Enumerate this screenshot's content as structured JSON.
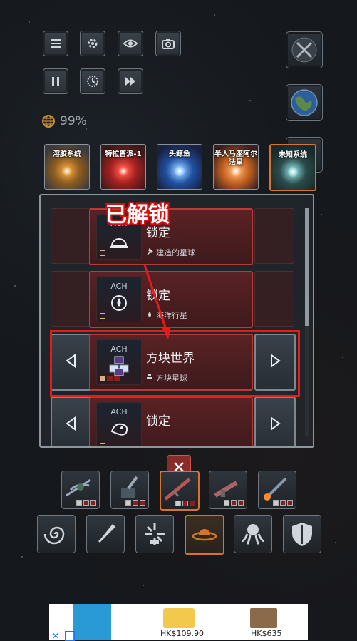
{
  "annotation": {
    "text": "已解锁"
  },
  "status": {
    "percent": "99%"
  },
  "systems": [
    {
      "label": "溶胶系统",
      "color": "#e8a040",
      "bg1": "#8a5a20",
      "bg2": "#3a3a3e",
      "selected": false
    },
    {
      "label": "特拉普派-1",
      "color": "#ff5a4a",
      "bg1": "#a02020",
      "bg2": "#3a1a1a",
      "selected": false
    },
    {
      "label": "头鲸鱼",
      "color": "#90c8ff",
      "bg1": "#2050a0",
      "bg2": "#1a2040",
      "selected": false
    },
    {
      "label": "半人马座阿尔法星",
      "color": "#ffb070",
      "bg1": "#c06020",
      "bg2": "#3a2020",
      "selected": false
    },
    {
      "label": "未知系统",
      "color": "#8ad0d0",
      "bg1": "#2a4a4a",
      "bg2": "#1a2a2a",
      "selected": true
    }
  ],
  "list": [
    {
      "ach": "ACH",
      "title": "锁定",
      "subtitle": "建造的星球",
      "sub_icon": "hammer-icon",
      "icon": "dome-icon",
      "unlocked": false,
      "arrows": false
    },
    {
      "ach": "ACH",
      "title": "锁定",
      "subtitle": "海洋行星",
      "sub_icon": "drop-icon",
      "icon": "drop-icon",
      "unlocked": false,
      "arrows": false
    },
    {
      "ach": "ACH",
      "title": "方块世界",
      "subtitle": "方块星球",
      "sub_icon": "cubes-icon",
      "icon": "cubes-icon",
      "unlocked": true,
      "arrows": true
    },
    {
      "ach": "ACH",
      "title": "锁定",
      "subtitle": "",
      "sub_icon": "",
      "icon": "creature-icon",
      "unlocked": false,
      "arrows": true
    }
  ],
  "weapons": [
    "alien-ship-icon",
    "turret-icon",
    "rifle-icon",
    "blaster-icon",
    "rocket-icon"
  ],
  "categories": [
    "spiral-icon",
    "dagger-icon",
    "burst-icon",
    "saucer-icon",
    "octopus-icon",
    "shield-icon"
  ],
  "ad": {
    "price1": "HK$109.90",
    "price2": "HK$635"
  }
}
